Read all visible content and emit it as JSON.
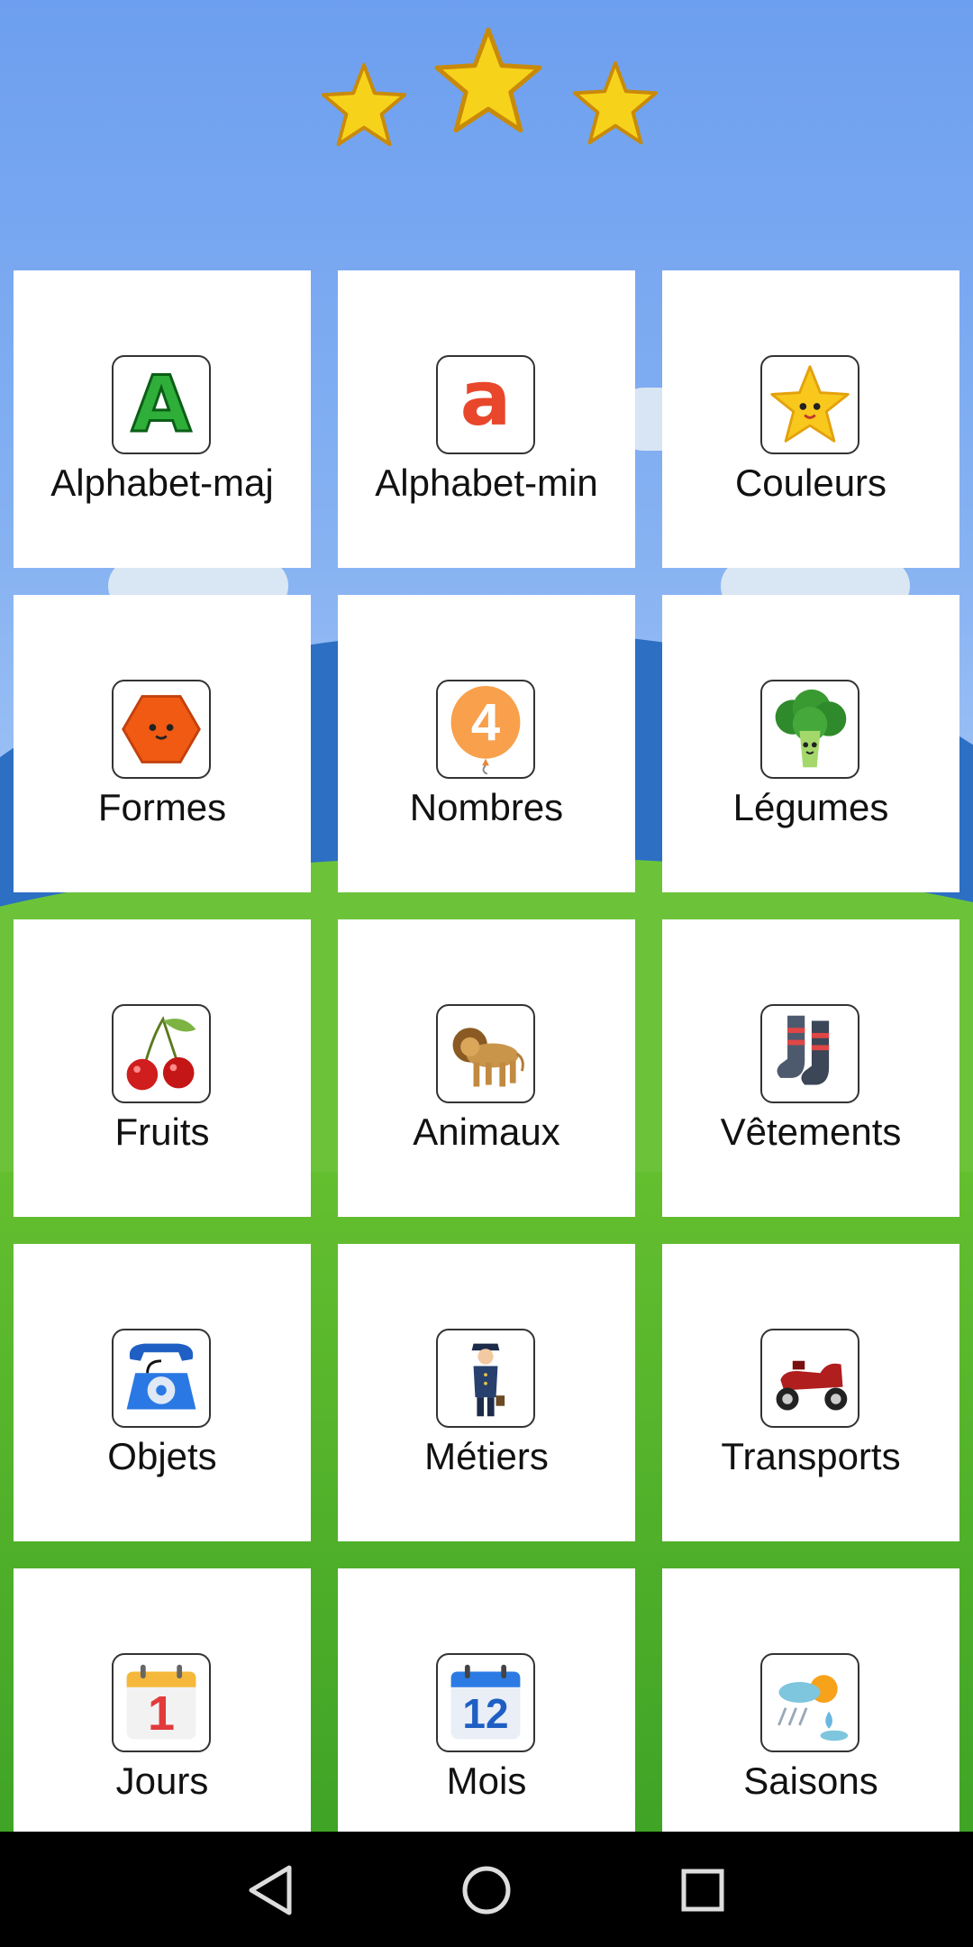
{
  "rating": {
    "stars": 3
  },
  "categories": [
    {
      "label": "Alphabet-maj",
      "icon": "letter-a-uppercase-icon"
    },
    {
      "label": "Alphabet-min",
      "icon": "letter-a-lowercase-icon"
    },
    {
      "label": "Couleurs",
      "icon": "smiling-star-icon"
    },
    {
      "label": "Formes",
      "icon": "hexagon-icon"
    },
    {
      "label": "Nombres",
      "icon": "number-balloon-icon"
    },
    {
      "label": "Légumes",
      "icon": "broccoli-icon"
    },
    {
      "label": "Fruits",
      "icon": "cherries-icon"
    },
    {
      "label": "Animaux",
      "icon": "lion-icon"
    },
    {
      "label": "Vêtements",
      "icon": "socks-icon"
    },
    {
      "label": "Objets",
      "icon": "telephone-icon"
    },
    {
      "label": "Métiers",
      "icon": "pilot-icon"
    },
    {
      "label": "Transports",
      "icon": "scooter-icon"
    },
    {
      "label": "Jours",
      "icon": "calendar-day-icon"
    },
    {
      "label": "Mois",
      "icon": "calendar-month-icon"
    },
    {
      "label": "Saisons",
      "icon": "weather-icon"
    }
  ],
  "icon_text": {
    "upper_a": "A",
    "lower_a": "a",
    "number": "4",
    "day": "1",
    "month": "12"
  },
  "navbar": {
    "back": "back-icon",
    "home": "home-icon",
    "recents": "recents-icon"
  },
  "colors": {
    "star": "#f7d21b",
    "tile": "#ffffff",
    "sky": "#7aa8f0",
    "grass": "#5dbb2e",
    "navbar": "#000000"
  }
}
